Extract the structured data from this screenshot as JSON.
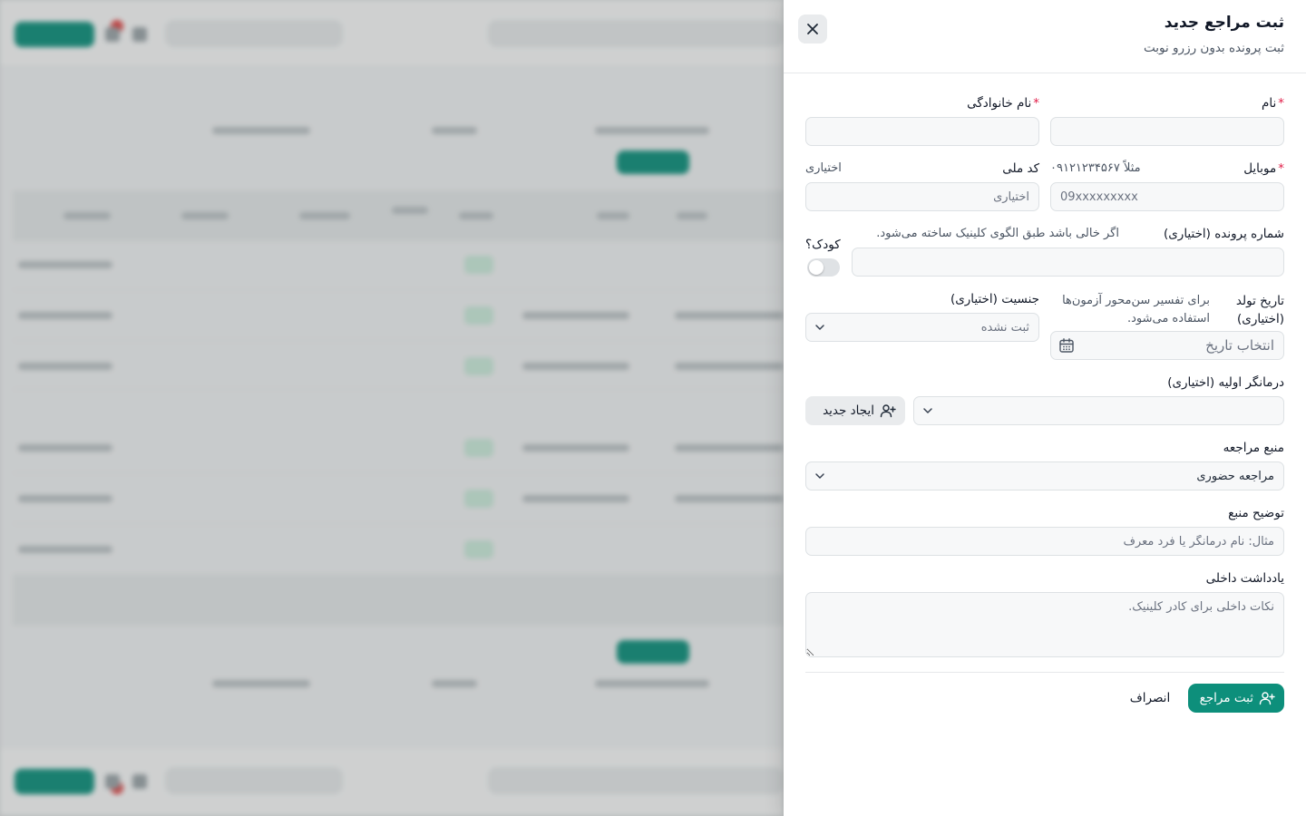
{
  "drawer": {
    "title": "ثبت مراجع جدید",
    "subtitle": "ثبت پرونده بدون رزرو نوبت"
  },
  "form": {
    "first_name": {
      "label": "نام",
      "required_mark": "*",
      "value": ""
    },
    "last_name": {
      "label": "نام خانوادگی",
      "required_mark": "*",
      "value": ""
    },
    "mobile": {
      "label": "موبایل",
      "required_mark": "*",
      "hint": "مثلاً ۰۹۱۲۱۲۳۴۵۶۷",
      "placeholder": "09xxxxxxxxx"
    },
    "national_code": {
      "label": "کد ملی",
      "hint": "اختیاری",
      "placeholder": "اختیاری"
    },
    "file_number": {
      "label": "شماره پرونده (اختیاری)",
      "hint": "اگر خالی باشد طبق الگوی کلینیک ساخته می‌شود.",
      "value": ""
    },
    "is_child": {
      "label": "کودک؟",
      "checked": false
    },
    "birth_date": {
      "label_line1": "تاریخ تولد",
      "label_line2": "(اختیاری)",
      "hint_line1": "برای تفسیر سن‌محور آزمون‌ها",
      "hint_line2": "استفاده می‌شود.",
      "placeholder": "انتخاب تاریخ"
    },
    "gender": {
      "label": "جنسیت (اختیاری)",
      "selected": "ثبت نشده"
    },
    "therapist": {
      "label": "درمانگر اولیه (اختیاری)",
      "selected": "",
      "create_label": "ایجاد جدید"
    },
    "referral_source": {
      "label": "منبع مراجعه",
      "selected": "مراجعه حضوری"
    },
    "source_description": {
      "label": "توضیح منبع",
      "placeholder": "مثال: نام درمانگر یا فرد معرف"
    },
    "internal_note": {
      "label": "یادداشت داخلی",
      "placeholder": "نکات داخلی برای کادر کلینیک."
    }
  },
  "actions": {
    "submit_label": "ثبت مراجع",
    "cancel_label": "انصراف"
  },
  "colors": {
    "primary": "#0d8f7b",
    "required": "#e11d48",
    "input_bg": "#f7f8f9",
    "border": "#dde1e4"
  },
  "icons": {
    "close": "close-icon",
    "calendar": "calendar-icon",
    "chevron": "chevron-down-icon",
    "user_plus": "user-plus-icon"
  }
}
